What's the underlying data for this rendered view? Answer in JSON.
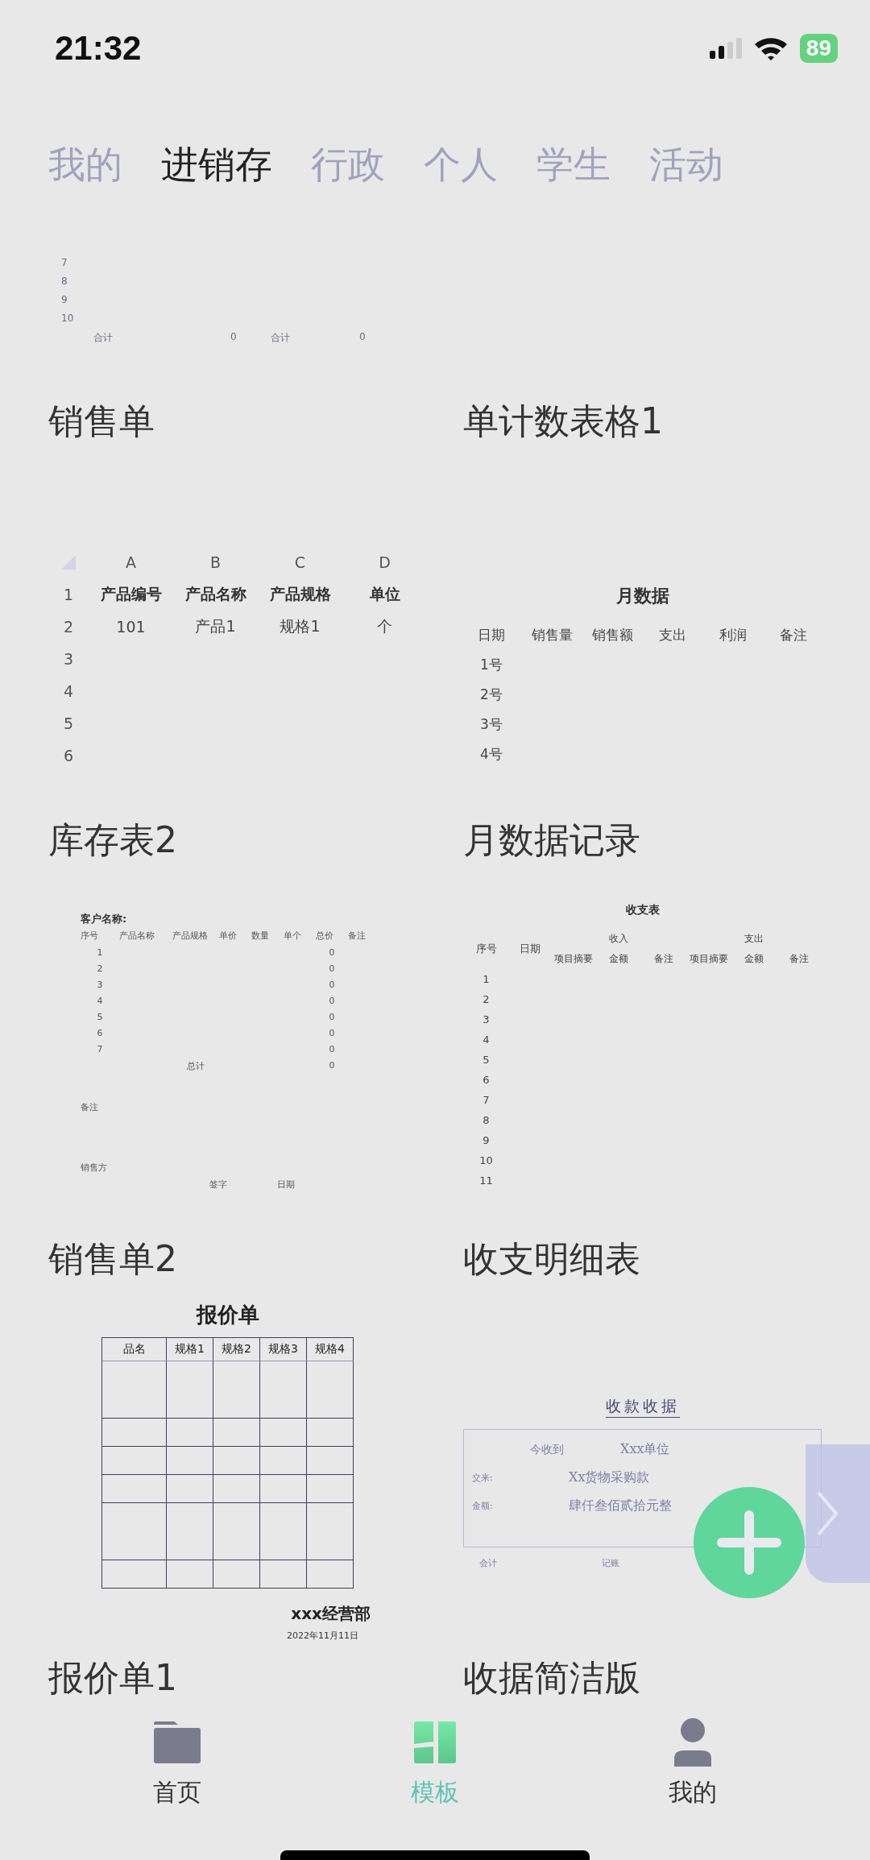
{
  "status_bar": {
    "time": "21:32",
    "battery": "89"
  },
  "tabs": [
    {
      "label": "我的",
      "selected": false
    },
    {
      "label": "进销存",
      "selected": true
    },
    {
      "label": "行政",
      "selected": false
    },
    {
      "label": "个人",
      "selected": false
    },
    {
      "label": "学生",
      "selected": false
    },
    {
      "label": "活动",
      "selected": false
    }
  ],
  "templates": [
    {
      "title": "销售单",
      "preview": {
        "kind": "row_tail",
        "row_numbers": [
          "7",
          "8",
          "9",
          "10"
        ],
        "totals": [
          "合计",
          "0",
          "合计",
          "0"
        ]
      }
    },
    {
      "title": "单计数表格1"
    },
    {
      "title": "库存表2",
      "preview": {
        "kind": "sheet",
        "columns": [
          "A",
          "B",
          "C",
          "D"
        ],
        "header": {
          "number": "1",
          "cells": [
            "产品编号",
            "产品名称",
            "产品规格",
            "单位"
          ]
        },
        "rows": [
          {
            "number": "2",
            "cells": [
              "101",
              "产品1",
              "规格1",
              "个"
            ]
          },
          {
            "number": "3"
          },
          {
            "number": "4"
          },
          {
            "number": "5"
          },
          {
            "number": "6"
          }
        ]
      }
    },
    {
      "title": "月数据记录",
      "preview": {
        "kind": "monthly",
        "heading": "月数据",
        "columns": [
          "日期",
          "销售量",
          "销售额",
          "支出",
          "利润",
          "备注"
        ],
        "rows": [
          "1号",
          "2号",
          "3号",
          "4号"
        ]
      }
    },
    {
      "title": "销售单2",
      "preview": {
        "kind": "sales_form",
        "customer_label": "客户名称:",
        "columns": [
          "序号",
          "产品名称",
          "产品规格",
          "单价",
          "数量",
          "单个",
          "总价",
          "备注"
        ],
        "rows": [
          {
            "number": "1",
            "total": "0"
          },
          {
            "number": "2",
            "total": "0"
          },
          {
            "number": "3",
            "total": "0"
          },
          {
            "number": "4",
            "total": "0"
          },
          {
            "number": "5",
            "total": "0"
          },
          {
            "number": "6",
            "total": "0"
          },
          {
            "number": "7",
            "total": "0"
          }
        ],
        "sum_label": "总计",
        "sum_total": "0",
        "note_label": "备注",
        "seller_label": "销售方",
        "sign_label": "签字",
        "date_label": "日期"
      }
    },
    {
      "title": "收支明细表",
      "preview": {
        "kind": "ledger",
        "heading": "收支表",
        "key_columns": [
          "序号",
          "日期"
        ],
        "groups": [
          {
            "label": "收入",
            "columns": [
              "项目摘要",
              "金额",
              "备注"
            ]
          },
          {
            "label": "支出",
            "columns": [
              "项目摘要",
              "金额",
              "备注"
            ]
          }
        ],
        "rows": [
          "1",
          "2",
          "3",
          "4",
          "5",
          "6",
          "7",
          "8",
          "9",
          "10",
          "11"
        ]
      }
    },
    {
      "title": "报价单1",
      "preview": {
        "kind": "quote",
        "heading": "报价单",
        "columns": [
          "品名",
          "规格1",
          "规格2",
          "规格3",
          "规格4"
        ],
        "company": "xxx经营部",
        "date": "2022年11月11日"
      }
    },
    {
      "title": "收据简洁版",
      "preview": {
        "kind": "receipt",
        "heading": "收款收据",
        "lines": [
          {
            "label": "今收到",
            "value": "Xxx单位"
          },
          {
            "label": "交来:",
            "value": "Xx货物采购款"
          },
          {
            "label": "金额:",
            "value": "肆仟叁佰贰拾元整"
          }
        ],
        "signatures": [
          "会计",
          "记账"
        ]
      }
    }
  ],
  "nav": [
    {
      "label": "首页",
      "kind": "folder",
      "selected": false
    },
    {
      "label": "模板",
      "kind": "template",
      "selected": true
    },
    {
      "label": "我的",
      "kind": "person",
      "selected": false
    }
  ]
}
